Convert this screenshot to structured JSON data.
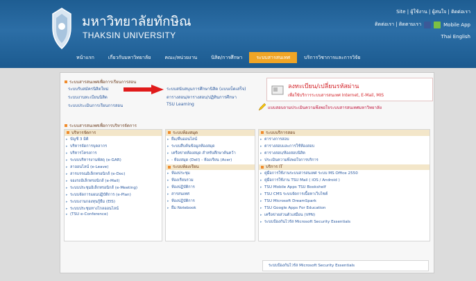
{
  "header": {
    "title_th": "มหาวิทยาลัยทักษิณ",
    "title_en": "THAKSIN UNIVERSITY",
    "top_links": "Site | ผู้ใช้งาน | ผู้สนใจ | ติดต่อเรา",
    "top_links2": "ติดต่อเรา | ติดตามเรา",
    "mobile": "Mobile App",
    "lang": "Thai  English"
  },
  "nav": [
    {
      "label": "หน้าแรก"
    },
    {
      "label": "เกี่ยวกับมหาวิทยาลัย"
    },
    {
      "label": "คณะ/หน่วยงาน"
    },
    {
      "label": "นิสิต/การศึกษา"
    },
    {
      "label": "ระบบสารสนเทศ",
      "active": true
    },
    {
      "label": "บริการวิชาการและการวิจัย"
    }
  ],
  "main": {
    "section1_title": "ระบบสารสนเทศเพื่อการเรียนการสอน",
    "col1": [
      "ระบบรับสมัครนิสิตใหม่",
      "ระบบงานทะเบียนนิสิต",
      "ระบบประเมินการเรียนการสอน"
    ],
    "col2": [
      "ระบบสนับสนุนการศึกษานิสิต (แบบเบ็ดเสร็จ)",
      "ตารางสอน/ตารางสอบ/ปฏิทินการศึกษา",
      "TSU Learning"
    ],
    "register_title": "ลงทะเบียน/เปลี่ยนรหัสผ่าน",
    "register_sub": "เพื่อใช้บริการระบบสารสนเทศ Internet, E-Mail, MIS",
    "survey": "แบบสอบถามประเมินความพึงพอใจระบบสารสนเทศมหาวิทยาลัย",
    "section2_title": "ระบบสารสนเทศเพื่อการบริหารจัดการ",
    "box1": {
      "title": "บริหารจัดการ",
      "items": [
        "บัญชี 3 มิติ",
        "บริหารจัดการบุคลากร",
        "บริหารโครงการ",
        "ระบบบริหารงานพัสดุ (e-GAR)",
        "ลาออนไลน์ (e-Leave)",
        "สารบรรณอิเล็กทรอนิกส์ (e-Doc)",
        "จองรถอิเล็กทรอนิกส์ (e-Mail)",
        "ระบบประชุมอิเล็กทรอนิกส์ (e-Meeting)",
        "ระบบจัดการแผนปฏิบัติการ (e-Plan)",
        "ระบบงานกองทุนกู้ยืม (EIS)",
        "ระบบประชุมทางไกลออนไลน์",
        "(TSU e-Conference)"
      ]
    },
    "box2": {
      "title": "ระบบห้องสมุด",
      "items": [
        "ยืม/คืนออนไลน์",
        "ระบบสืบค้นข้อมูลห้องสมุด",
        "เครือข่ายห้องสมุด สำหรับศึกษาค้นคว้า",
        "- ห้องสมุด (Dell)   - ห้องเรียน (Acer)"
      ],
      "sub_title": "ระบบห้องเรียน",
      "sub_items": [
        "ห้องประชุม",
        "ห้องเรียนรวม",
        "ห้องปฏิบัติการ",
        "สารสนเทศ",
        "ห้องปฏิบัติการ",
        "ยืม Notebook"
      ]
    },
    "box3": {
      "title": "ระบบบริการสอบ",
      "items": [
        "ตารางการสอบ",
        "ตารางสอบและการใช้ห้องสอบ",
        "ตารางสอบ/ห้องสอบนิสิต",
        "ประเมินความพึงพอใจการบริการ"
      ],
      "sub_title": "บริการ IT",
      "sub_items": [
        "คู่มือการใช้งานระบบสารสนเทศ  ระบบ MS Office 2550",
        "คู่มือการใช้งาน TSU Mail  ( iOS / Android )",
        "TSU Mobile Apps        TSU Bookshelf",
        "TSU CMS ระบบจัดการเนื้อหาเว็บไซต์",
        "TSU Microsoft DreamSpark",
        "TSU Google Apps For Education",
        "เครือข่ายส่วนตัวเสมือน (VPN)",
        "ระบบป้องกันไวรัส Microsoft Security Essentials"
      ]
    },
    "bottom_link": "ระบบป้องกันไวรัส Microsoft Security Essentials"
  },
  "colors": {
    "header": "#1e5d92",
    "accent": "#f0a526",
    "link": "#2b5aa0",
    "alert": "#d3242a"
  }
}
